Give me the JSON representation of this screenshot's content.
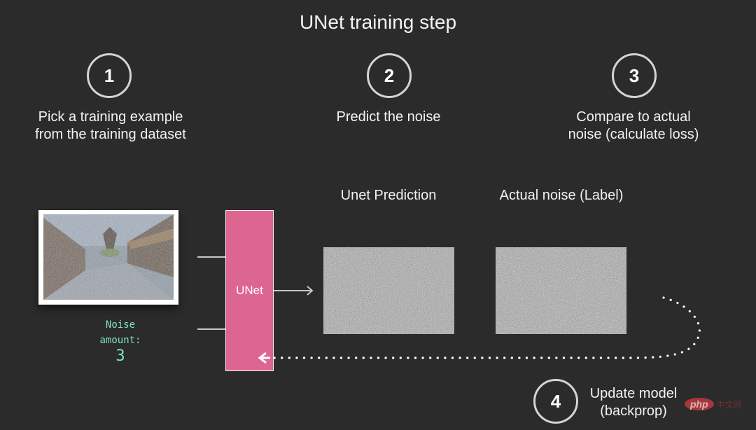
{
  "title": "UNet training step",
  "steps": [
    {
      "number": "1",
      "lines": [
        "Pick a training example",
        "from the training dataset"
      ]
    },
    {
      "number": "2",
      "lines": [
        "Predict the noise"
      ]
    },
    {
      "number": "3",
      "lines": [
        "Compare to actual",
        "noise (calculate loss)"
      ]
    },
    {
      "number": "4",
      "lines": [
        "Update model",
        "(backprop)"
      ]
    }
  ],
  "input": {
    "noise_label_line1": "Noise",
    "noise_label_line2": "amount:",
    "noise_amount": "3"
  },
  "model": {
    "label": "UNet"
  },
  "outputs": {
    "prediction_label": "Unet Prediction",
    "actual_label": "Actual noise (Label)"
  },
  "colors": {
    "background": "#2b2b2b",
    "unet": "#dd6690",
    "noise_text": "#7fe3c8"
  },
  "watermark": {
    "brand": "php",
    "suffix": "中文网"
  }
}
